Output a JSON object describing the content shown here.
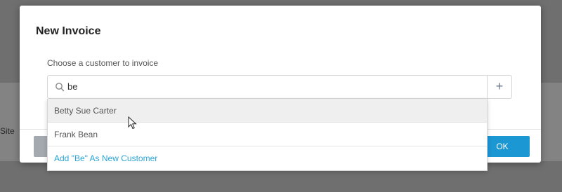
{
  "background": {
    "partial_text": "Site"
  },
  "modal": {
    "title": "New Invoice",
    "label": "Choose a customer to invoice",
    "search": {
      "value": "be",
      "icon": "search-icon"
    },
    "add_button": "+",
    "ok_button": "OK"
  },
  "dropdown": {
    "items": [
      {
        "label": "Betty Sue Carter",
        "highlighted": true
      },
      {
        "label": "Frank Bean",
        "highlighted": false
      }
    ],
    "add_new": "Add \"Be\" As New Customer"
  },
  "colors": {
    "accent": "#1b97d4",
    "link": "#2aa5d8",
    "highlight": "#efefef"
  }
}
